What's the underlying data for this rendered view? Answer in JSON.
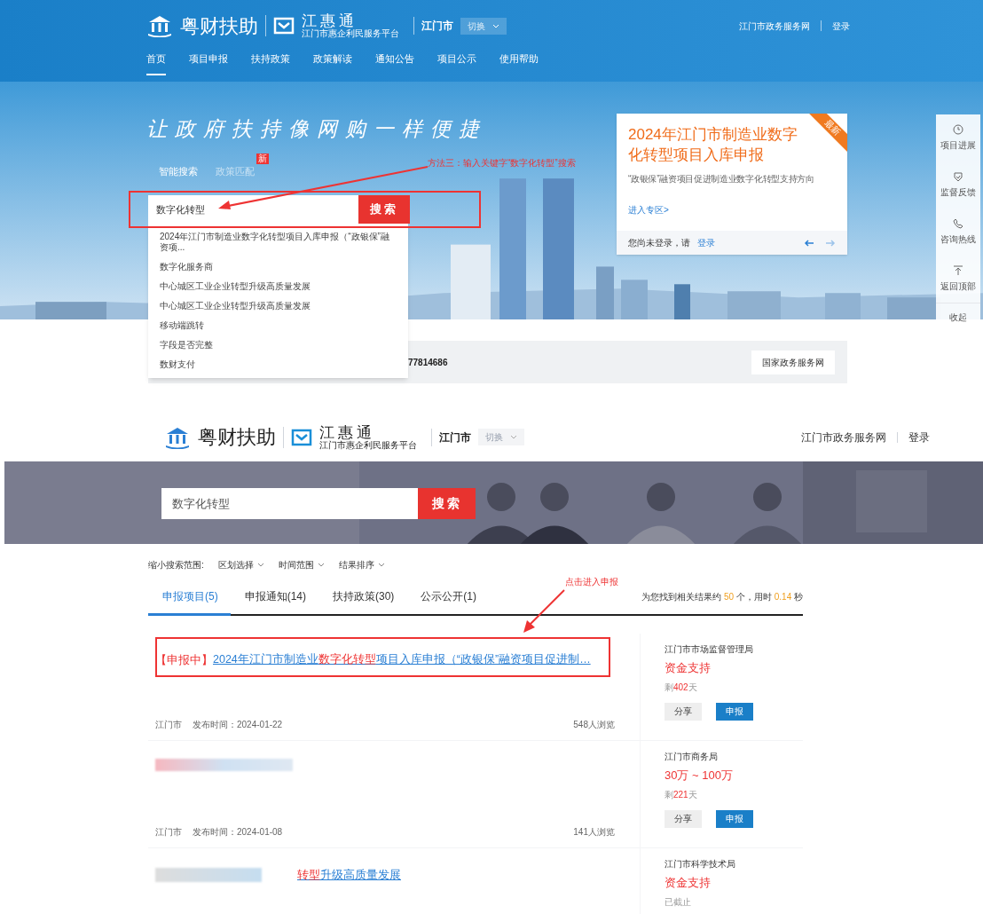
{
  "top_screen": {
    "header": {
      "logo_title": "粤财扶助",
      "platform": "江惠通",
      "platform_sub": "江门市惠企利民服务平台",
      "city": "江门市",
      "switch": "切换",
      "links": [
        "江门市政务服务网",
        "登录"
      ]
    },
    "nav": [
      {
        "label": "首页",
        "selected": true
      },
      {
        "label": "项目申报",
        "selected": false
      },
      {
        "label": "扶持政策",
        "selected": false
      },
      {
        "label": "政策解读",
        "selected": false
      },
      {
        "label": "通知公告",
        "selected": false
      },
      {
        "label": "项目公示",
        "selected": false
      },
      {
        "label": "使用帮助",
        "selected": false
      }
    ],
    "hero": {
      "slogan": "让政府扶持像网购一样便捷",
      "search_tabs": [
        {
          "label": "智能搜索",
          "selected": true
        },
        {
          "label": "政策匹配",
          "selected": false,
          "badge": "新"
        }
      ],
      "search": {
        "value": "数字化转型",
        "button": "搜索"
      },
      "suggestions": [
        "2024年江门市制造业数字化转型项目入库申报（“政银保”融资项...",
        "数字化服务商",
        "中心城区工业企业转型升级高质量发展",
        "中心城区工业企业转型升级高质量发展",
        "移动端跳转",
        "字段是否完整",
        "数财支付"
      ],
      "annotation": "方法三：输入关键字“数字化转型”搜索"
    },
    "feature_card": {
      "ribbon": "最新",
      "title": "2024年江门市制造业数字化转型项目入库申报",
      "subtitle": "“政银保”融资项目促进制造业数字化转型支持方向",
      "link": "进入专区>",
      "login_prompt": "您尚未登录，请",
      "login_link": "登录"
    },
    "side_tools": [
      {
        "kind": "clock",
        "label": "项目进展"
      },
      {
        "kind": "shield",
        "label": "监督反馈"
      },
      {
        "kind": "phone",
        "label": "咨询热线"
      },
      {
        "kind": "top",
        "label": "返回顶部"
      },
      {
        "kind": "text",
        "label": "收起"
      }
    ],
    "info_bar": {
      "phone_fragment": "77814686",
      "button": "国家政务服务网"
    }
  },
  "bottom_screen": {
    "header": {
      "logo_title": "粤财扶助",
      "platform": "江惠通",
      "platform_sub": "江门市惠企利民服务平台",
      "city": "江门市",
      "switch": "切换",
      "links": [
        "江门市政务服务网",
        "登录"
      ]
    },
    "search": {
      "value": "数字化转型",
      "button": "搜索"
    },
    "filters": {
      "label": "缩小搜索范围:",
      "options": [
        "区划选择",
        "时间范围",
        "结果排序"
      ]
    },
    "tabs": [
      {
        "label": "申报项目(5)",
        "selected": true
      },
      {
        "label": "申报通知(14)",
        "selected": false
      },
      {
        "label": "扶持政策(30)",
        "selected": false
      },
      {
        "label": "公示公开(1)",
        "selected": false
      }
    ],
    "summary": {
      "prefix": "为您找到相关结果约",
      "count": "50",
      "middle": "个，用时",
      "time": "0.14",
      "suffix": "秒"
    },
    "annotation": "点击进入申报",
    "results": [
      {
        "kind": "full",
        "status": "【申报中】",
        "title_before": "2024年江门市制造业",
        "title_highlight": "数字化转型",
        "title_after": "项目入库申报（“政银保”融资项目促进制…",
        "region": "江门市",
        "date": "发布时间：2024-01-22",
        "views": "548人浏览",
        "department": "江门市市场监督管理局",
        "amount": "资金支持",
        "remaining_prefix": "剩",
        "remaining_days": "402",
        "remaining_suffix": "天",
        "buttons": [
          "分享",
          "申报"
        ]
      },
      {
        "kind": "redacted",
        "region": "江门市",
        "date": "发布时间：2024-01-08",
        "views": "141人浏览",
        "department": "江门市商务局",
        "amount": "30万 ~ 100万",
        "remaining_prefix": "剩",
        "remaining_days": "221",
        "remaining_suffix": "天",
        "buttons": [
          "分享",
          "申报"
        ]
      },
      {
        "kind": "partly_redacted",
        "title_highlight": "转型",
        "title_after": "升级高质量发展",
        "department": "江门市科学技术局",
        "amount": "资金支持",
        "closed": "已截止"
      }
    ]
  }
}
